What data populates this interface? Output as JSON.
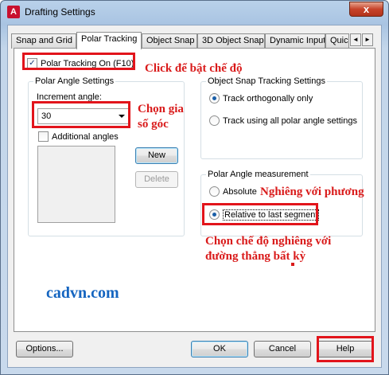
{
  "window": {
    "title": "Drafting Settings",
    "close_label": "x",
    "app_icon_letter": "A"
  },
  "tabs": [
    {
      "label": "Snap and Grid"
    },
    {
      "label": "Polar Tracking"
    },
    {
      "label": "Object Snap"
    },
    {
      "label": "3D Object Snap"
    },
    {
      "label": "Dynamic Input"
    },
    {
      "label": "Quic"
    }
  ],
  "tab_scroll": {
    "left": "◄",
    "right": "►"
  },
  "polar": {
    "toggle_label": "Polar Tracking On (F10)",
    "toggle_check": "✓",
    "angle_group_title": "Polar Angle Settings",
    "increment_label": "Increment angle:",
    "increment_value": "30",
    "additional_label": "Additional angles",
    "new_button": "New",
    "delete_button": "Delete"
  },
  "osnap": {
    "group_title": "Object Snap Tracking Settings",
    "opt1": "Track orthogonally only",
    "opt2": "Track using all polar angle settings"
  },
  "measure": {
    "group_title": "Polar Angle measurement",
    "opt1": "Absolute",
    "opt2": "Relative to last segment"
  },
  "footer": {
    "options": "Options...",
    "ok": "OK",
    "cancel": "Cancel",
    "help": "Help"
  },
  "annotations": {
    "click_on": "Click để bật chế độ",
    "choose_angle_1": "Chọn gia",
    "choose_angle_2": "số góc",
    "tilt_direction": "Nghiêng với phương",
    "tilt_mode_1": "Chọn chế độ nghiêng với",
    "tilt_mode_2": "đường thẳng bất kỳ",
    "site": "cadvn.com"
  },
  "colors": {
    "annotation_red": "#d91a1a",
    "highlight_red": "#e2141b",
    "site_blue": "#1565c0"
  }
}
